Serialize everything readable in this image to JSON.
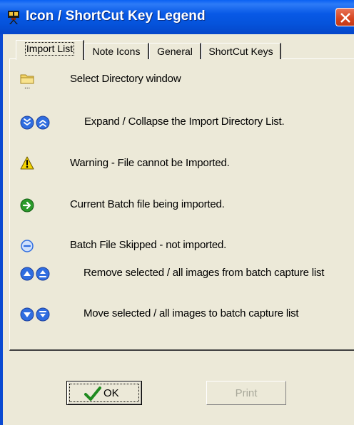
{
  "window": {
    "title": "Icon / ShortCut Key Legend",
    "app_icon": "film-camera-icon",
    "close_icon": "close-icon"
  },
  "tabs": [
    {
      "label": "Import List",
      "active": true
    },
    {
      "label": "Note Icons",
      "active": false
    },
    {
      "label": "General",
      "active": false
    },
    {
      "label": "ShortCut Keys",
      "active": false
    }
  ],
  "legend": [
    {
      "icons": [
        "folder-icon"
      ],
      "text": "Select Directory window"
    },
    {
      "icons": [
        "expand-icon",
        "collapse-icon"
      ],
      "text": "Expand / Collapse the Import Directory List."
    },
    {
      "icons": [
        "warning-icon"
      ],
      "text": "Warning - File cannot be Imported."
    },
    {
      "icons": [
        "current-batch-arrow-icon"
      ],
      "text": "Current Batch file being imported."
    },
    {
      "icons": [
        "skipped-minus-icon"
      ],
      "text": "Batch File Skipped  - not imported."
    },
    {
      "icons": [
        "remove-selected-icon",
        "remove-all-icon"
      ],
      "text": "Remove selected / all images from batch capture list"
    },
    {
      "icons": [
        "move-selected-icon",
        "move-all-icon"
      ],
      "text": "Move selected / all images to batch capture list"
    }
  ],
  "buttons": {
    "ok_label": "OK",
    "ok_icon": "checkmark-icon",
    "print_label": "Print",
    "print_enabled": false
  },
  "colors": {
    "titlebar": "#0553db",
    "dialog_bg": "#ece9d8",
    "close_button": "#d6441e",
    "icon_blue": "#2f6de0",
    "arrow_green": "#2a9a2a",
    "warning_yellow": "#f5d400"
  }
}
